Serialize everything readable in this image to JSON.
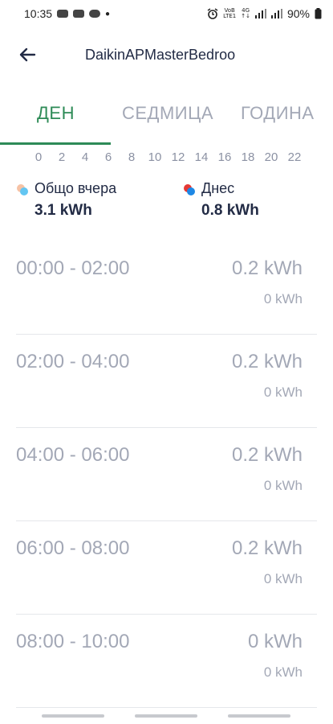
{
  "status_bar": {
    "time": "10:35",
    "battery_percent": "90%",
    "net_top": "VoB",
    "net_bottom": "LTE1",
    "net_4g": "4G",
    "net_4g_sub": "↑↓"
  },
  "header": {
    "title": "DaikinAPMasterBedroo",
    "back_icon": "arrow-left-icon"
  },
  "tabs": [
    {
      "label": "ДЕН",
      "active": true
    },
    {
      "label": "СЕДМИЦА",
      "active": false
    },
    {
      "label": "ГОДИНА",
      "active": false
    }
  ],
  "hour_axis": [
    "0",
    "2",
    "4",
    "6",
    "8",
    "10",
    "12",
    "14",
    "16",
    "18",
    "20",
    "22"
  ],
  "legend": {
    "yesterday": {
      "label": "Общо вчера",
      "value": "3.1 kWh",
      "colors": [
        "#f6c2a5",
        "#63c6f2"
      ]
    },
    "today": {
      "label": "Днес",
      "value": "0.8 kWh",
      "colors": [
        "#e53935",
        "#1e88e5"
      ]
    }
  },
  "rows": [
    {
      "range": "00:00 - 02:00",
      "main": "0.2 kWh",
      "sub": "0 kWh"
    },
    {
      "range": "02:00 - 04:00",
      "main": "0.2 kWh",
      "sub": "0 kWh"
    },
    {
      "range": "04:00 - 06:00",
      "main": "0.2 kWh",
      "sub": "0 kWh"
    },
    {
      "range": "06:00 - 08:00",
      "main": "0.2 kWh",
      "sub": "0 kWh"
    },
    {
      "range": "08:00 - 10:00",
      "main": "0 kWh",
      "sub": "0 kWh"
    }
  ],
  "colors": {
    "accent": "#2e8b57",
    "muted": "#a3a8b6",
    "text": "#222b45"
  }
}
